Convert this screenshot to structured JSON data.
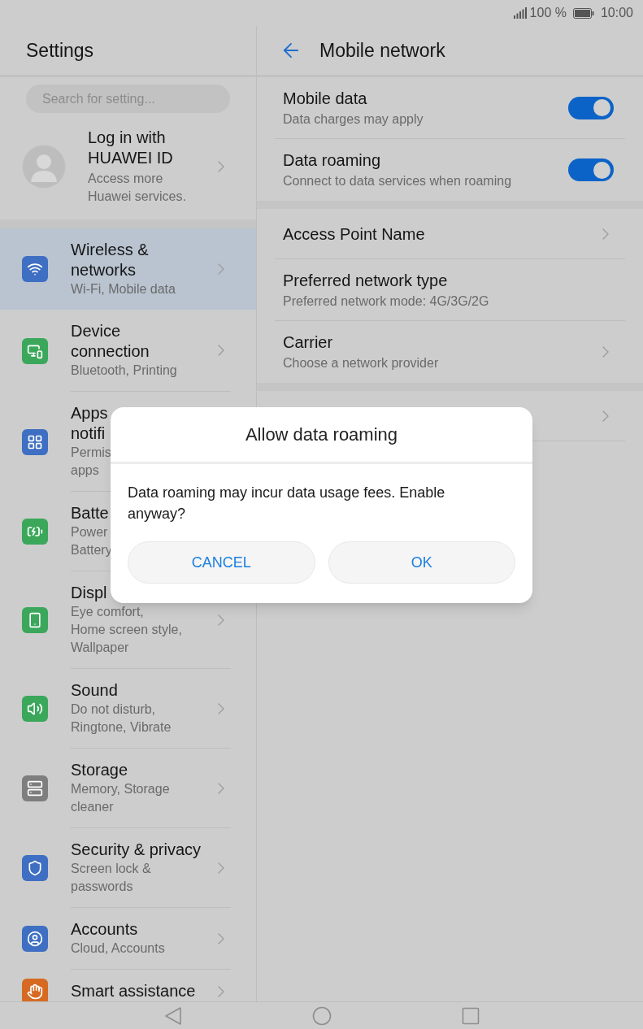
{
  "status_bar": {
    "battery": "100 %",
    "time": "10:00"
  },
  "sidebar": {
    "title": "Settings",
    "search": {
      "placeholder": "Search for setting..."
    },
    "account": {
      "title_lines": [
        "Log in with",
        "HUAWEI ID"
      ],
      "subtitle_lines": [
        "Access more",
        "Huawei services."
      ]
    },
    "items": [
      {
        "kind": "wifi",
        "color": "#3e6fc2",
        "title_lines": [
          "Wireless &",
          "networks"
        ],
        "subtitle_lines": [
          "Wi-Fi, Mobile data"
        ],
        "selected": true
      },
      {
        "kind": "devices",
        "color": "#3ba75b",
        "title_lines": [
          "Device",
          "connection"
        ],
        "subtitle_lines": [
          "Bluetooth, Printing"
        ],
        "selected": false
      },
      {
        "kind": "grid",
        "color": "#3e6fc2",
        "title_lines": [
          "Apps",
          "notifi"
        ],
        "subtitle_lines": [
          "Permis",
          "apps"
        ],
        "selected": false
      },
      {
        "kind": "battery",
        "color": "#3ba75b",
        "title_lines": [
          "Batte"
        ],
        "subtitle_lines": [
          "Power",
          "Battery"
        ],
        "selected": false
      },
      {
        "kind": "phone",
        "color": "#3ba75b",
        "title_lines": [
          "Displ"
        ],
        "subtitle_lines": [
          "Eye comfort,",
          "Home screen style,",
          "Wallpaper"
        ],
        "selected": false
      },
      {
        "kind": "speaker",
        "color": "#3ba75b",
        "title_lines": [
          "Sound"
        ],
        "subtitle_lines": [
          "Do not disturb,",
          "Ringtone, Vibrate"
        ],
        "selected": false
      },
      {
        "kind": "storage",
        "color": "#7e7e7e",
        "title_lines": [
          "Storage"
        ],
        "subtitle_lines": [
          "Memory, Storage",
          "cleaner"
        ],
        "selected": false
      },
      {
        "kind": "shield",
        "color": "#3e6fc2",
        "title_lines": [
          "Security & privacy"
        ],
        "subtitle_lines": [
          "Screen lock &",
          "passwords"
        ],
        "selected": false
      },
      {
        "kind": "person",
        "color": "#3e6fc2",
        "title_lines": [
          "Accounts"
        ],
        "subtitle_lines": [
          "Cloud, Accounts"
        ],
        "selected": false
      },
      {
        "kind": "hand",
        "color": "#d66a22",
        "title_lines": [
          "Smart assistance"
        ],
        "selected": false
      }
    ]
  },
  "page": {
    "title": "Mobile network",
    "sections": [
      {
        "rows": [
          {
            "kind": "switch",
            "title": "Mobile data",
            "subtitle": "Data charges may apply",
            "on": true
          },
          {
            "kind": "switch",
            "title": "Data roaming",
            "subtitle": "Connect to data services when roaming",
            "on": true
          }
        ]
      },
      {
        "rows": [
          {
            "kind": "link",
            "title": "Access Point Name"
          },
          {
            "kind": "plain",
            "title": "Preferred network type",
            "subtitle": "Preferred network mode: 4G/3G/2G"
          },
          {
            "kind": "link",
            "title": "Carrier",
            "subtitle": "Choose a network provider"
          }
        ]
      },
      {
        "rows": [
          {
            "kind": "link"
          }
        ]
      }
    ]
  },
  "dialog": {
    "title": "Allow data roaming",
    "message": "Data roaming may incur data usage fees. Enable anyway?",
    "buttons": [
      "CANCEL",
      "OK"
    ]
  }
}
